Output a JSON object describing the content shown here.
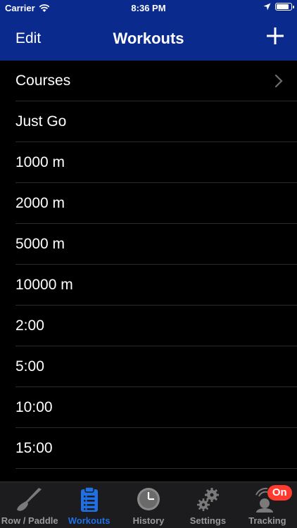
{
  "status_bar": {
    "carrier": "Carrier",
    "time": "8:36 PM",
    "battery_level": 0.9
  },
  "nav": {
    "edit_label": "Edit",
    "title": "Workouts",
    "add_icon": "plus-icon"
  },
  "workouts": [
    {
      "label": "Courses",
      "has_chevron": true
    },
    {
      "label": "Just Go"
    },
    {
      "label": "1000 m"
    },
    {
      "label": "2000 m"
    },
    {
      "label": "5000 m"
    },
    {
      "label": "10000 m"
    },
    {
      "label": "2:00"
    },
    {
      "label": "5:00"
    },
    {
      "label": "10:00"
    },
    {
      "label": "15:00"
    }
  ],
  "tabs": [
    {
      "label": "Row / Paddle",
      "icon": "oar-icon"
    },
    {
      "label": "Workouts",
      "icon": "clipboard-icon",
      "active": true
    },
    {
      "label": "History",
      "icon": "clock-icon"
    },
    {
      "label": "Settings",
      "icon": "gears-icon"
    },
    {
      "label": "Tracking",
      "icon": "location-person-icon",
      "badge": "On"
    }
  ],
  "colors": {
    "nav_background": "#0a2a8e",
    "active_tab": "#1f6fe5",
    "badge": "#ff3b30"
  }
}
